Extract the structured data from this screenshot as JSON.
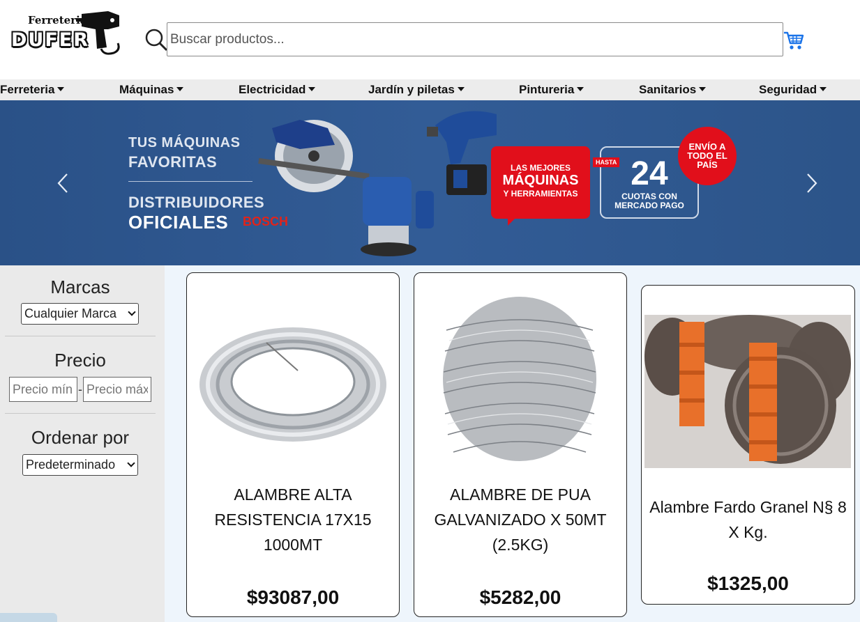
{
  "header": {
    "logo_top": "Ferreteria",
    "logo_main": "DUFER",
    "search_placeholder": "Buscar productos..."
  },
  "nav": {
    "items": [
      {
        "label": "Ferreteria"
      },
      {
        "label": "Máquinas"
      },
      {
        "label": "Electricidad"
      },
      {
        "label": "Jardín y piletas"
      },
      {
        "label": "Pintureria"
      },
      {
        "label": "Sanitarios"
      },
      {
        "label": "Seguridad"
      }
    ]
  },
  "banner": {
    "line1": "TUS MÁQUINAS",
    "line2": "FAVORITAS",
    "line3": "DISTRIBUIDORES",
    "line4": "OFICIALES",
    "brand": "BOSCH",
    "promo_small": "LAS MEJORES",
    "promo_big": "MÁQUINAS",
    "promo_small2": "Y HERRAMIENTAS",
    "hasta": "HASTA",
    "cuotas_num": "24",
    "cuotas_txt1": "CUOTAS CON",
    "cuotas_txt2": "MERCADO PAGO",
    "envio1": "ENVÍO A",
    "envio2": "TODO EL",
    "envio3": "PAÍS"
  },
  "filters": {
    "brands_title": "Marcas",
    "brands_selected": "Cualquier Marca",
    "price_title": "Precio",
    "price_min_placeholder": "Precio mín",
    "price_max_placeholder": "Precio máx",
    "sort_title": "Ordenar por",
    "sort_selected": "Predeterminado"
  },
  "products": [
    {
      "name": "ALAMBRE ALTA RESISTENCIA 17X15 1000MT",
      "price": "$93087,00"
    },
    {
      "name": "ALAMBRE DE PUA GALVANIZADO X 50MT (2.5KG)",
      "price": "$5282,00"
    },
    {
      "name": "Alambre Fardo Granel N§ 8 X Kg.",
      "price": "$1325,00"
    }
  ],
  "colors": {
    "banner_bg": "#2f5891",
    "promo_red": "#e10f1b",
    "cart_blue": "#1a73e8",
    "sidebar_bg": "#eaeaea",
    "products_bg": "#eef5fc"
  }
}
